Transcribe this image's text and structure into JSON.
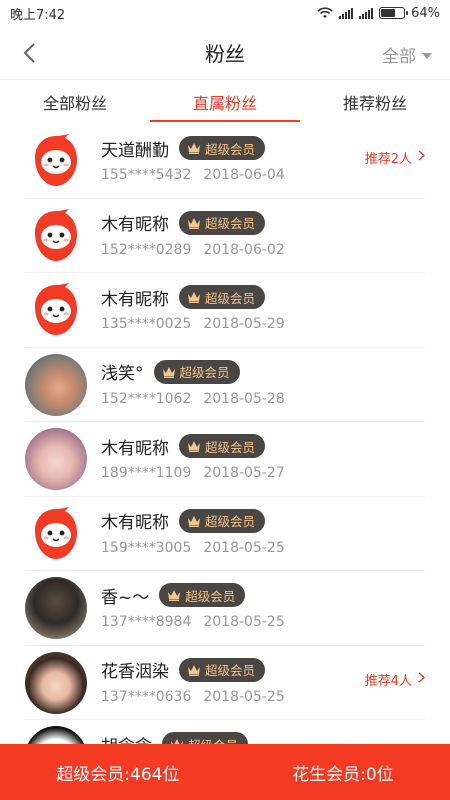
{
  "status_bar": {
    "time": "晚上7:42",
    "battery_percent": "64%",
    "battery_level": 0.64
  },
  "header": {
    "title": "粉丝",
    "filter_label": "全部"
  },
  "tabs": [
    {
      "label": "全部粉丝",
      "active": false
    },
    {
      "label": "直属粉丝",
      "active": true
    },
    {
      "label": "推荐粉丝",
      "active": false
    }
  ],
  "fans": [
    {
      "name": "天道酬勤",
      "badge": "超级会员",
      "phone": "155****5432",
      "date": "2018-06-04",
      "avatar": "mascot",
      "recommend": "推荐2人"
    },
    {
      "name": "木有昵称",
      "badge": "超级会员",
      "phone": "152****0289",
      "date": "2018-06-02",
      "avatar": "mascot",
      "recommend": ""
    },
    {
      "name": "木有昵称",
      "badge": "超级会员",
      "phone": "135****0025",
      "date": "2018-05-29",
      "avatar": "mascot",
      "recommend": ""
    },
    {
      "name": "浅笑°",
      "badge": "超级会员",
      "phone": "152****1062",
      "date": "2018-05-28",
      "avatar": "photo-a",
      "recommend": ""
    },
    {
      "name": "木有昵称",
      "badge": "超级会员",
      "phone": "189****1109",
      "date": "2018-05-27",
      "avatar": "photo-b",
      "recommend": ""
    },
    {
      "name": "木有昵称",
      "badge": "超级会员",
      "phone": "159****3005",
      "date": "2018-05-25",
      "avatar": "mascot",
      "recommend": ""
    },
    {
      "name": "香~～",
      "badge": "超级会员",
      "phone": "137****8984",
      "date": "2018-05-25",
      "avatar": "photo-c",
      "recommend": ""
    },
    {
      "name": "花香洇染",
      "badge": "超级会员",
      "phone": "137****0636",
      "date": "2018-05-25",
      "avatar": "photo-d",
      "recommend": "推荐4人"
    },
    {
      "name": "胡念念",
      "badge": "超级会员",
      "phone": "",
      "date": "",
      "avatar": "photo-e",
      "recommend": ""
    }
  ],
  "footer": {
    "super_members": "超级会员:464位",
    "peanut_members": "花生会员:0位"
  },
  "colors": {
    "accent": "#f23a24",
    "badge_bg": "#4a4643",
    "badge_text": "#f4c58c"
  }
}
